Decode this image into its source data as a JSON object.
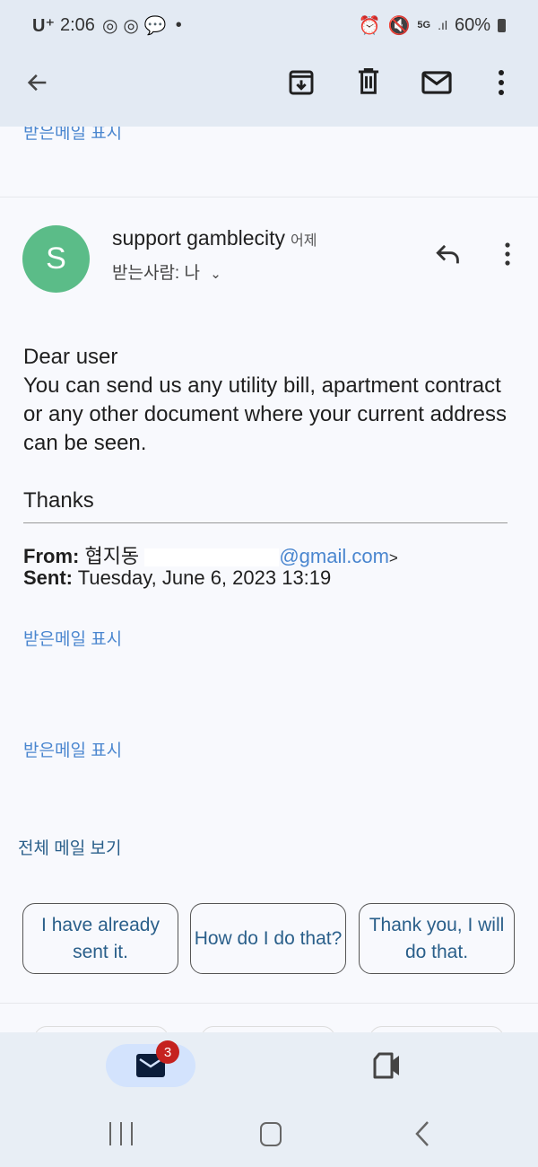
{
  "status_bar": {
    "carrier": "U⁺",
    "time": "2:06",
    "battery": "60%",
    "network": "5G"
  },
  "toolbar": {
    "icons": [
      "back-arrow-icon",
      "archive-icon",
      "trash-icon",
      "mark-unread-icon",
      "more-vert-icon"
    ]
  },
  "prev_message": {
    "show_quoted": "받은메일 표시"
  },
  "message": {
    "avatar_letter": "S",
    "avatar_color": "#5bbc88",
    "sender": "support gamblecity",
    "date": "어제",
    "to": "받는사람: 나",
    "body": [
      "Dear user",
      "You can send us any utility bill, apartment contract or any other document where your current address can be seen.",
      "",
      "Thanks"
    ],
    "from_label": "From:",
    "from_name": "협지동",
    "from_email": "@gmail.com",
    "from_suffix": ">",
    "sent_label": "Sent:",
    "sent_value": "Tuesday, June 6, 2023 13:19",
    "show_quoted_1": "받은메일 표시",
    "show_quoted_2": "받은메일 표시",
    "view_full": "전체 메일 보기"
  },
  "smart_replies": [
    "I have already sent it.",
    "How do I do that?",
    "Thank you, I will do that."
  ],
  "bottom_nav": {
    "mail_badge": "3"
  }
}
